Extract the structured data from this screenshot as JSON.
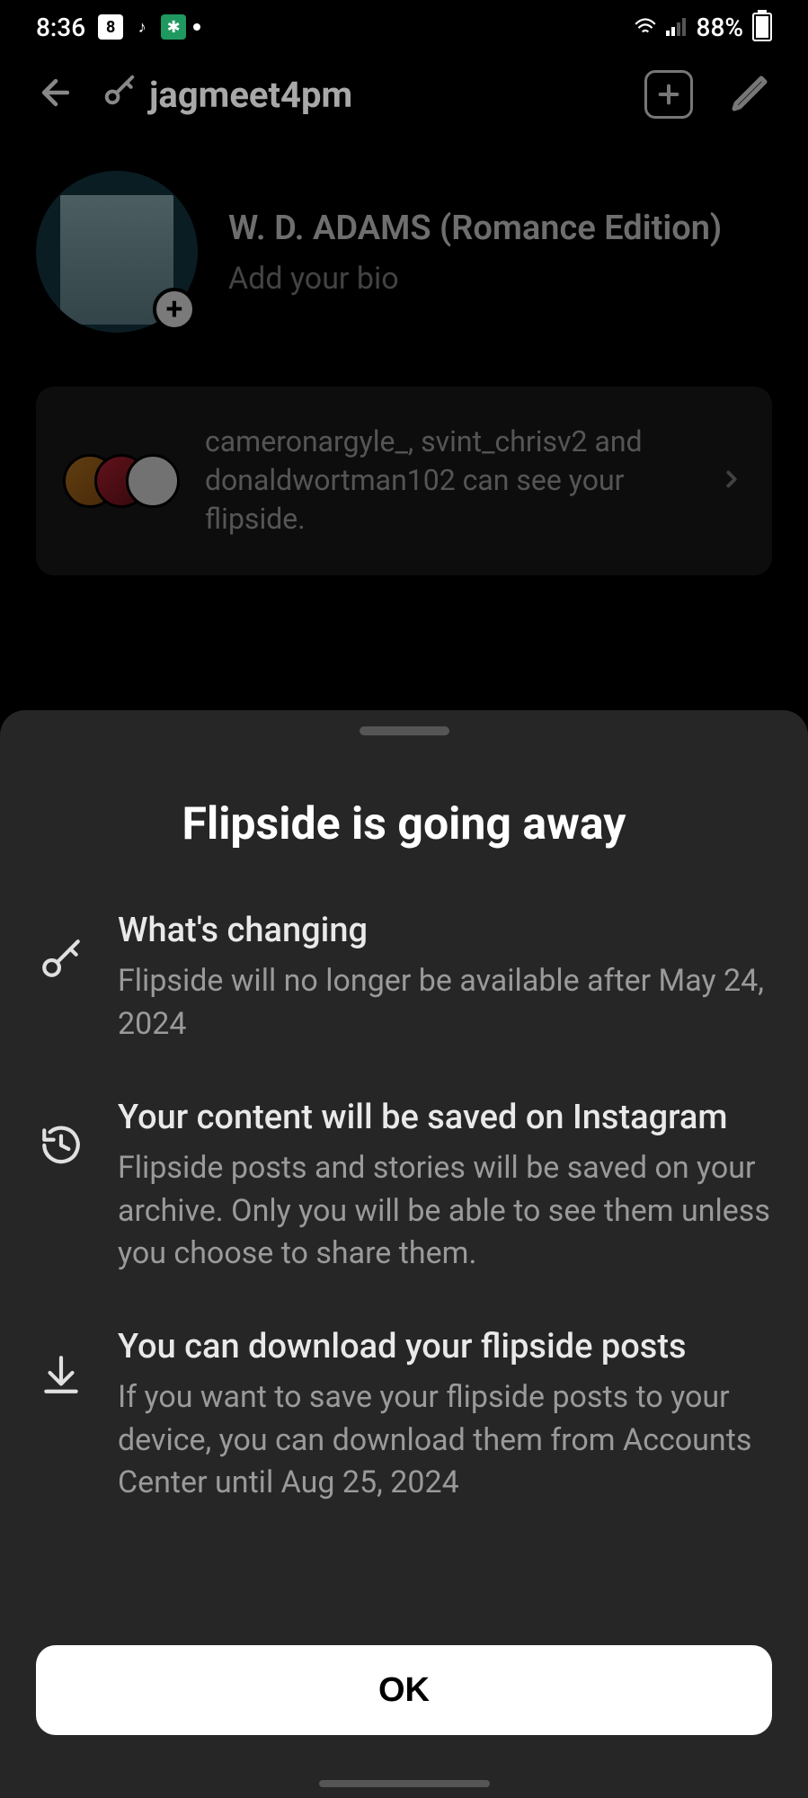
{
  "status": {
    "time": "8:36",
    "battery_pct": "88%"
  },
  "header": {
    "username": "jagmeet4pm"
  },
  "profile": {
    "display_name": "W. D. ADAMS (Romance Edition)",
    "bio_prompt": "Add your bio"
  },
  "viewers": {
    "text": "cameronargyle_, svint_chrisv2 and donaldwortman102 can see your flipside."
  },
  "sheet": {
    "title": "Flipside is going away",
    "items": [
      {
        "title": "What's changing",
        "body": "Flipside will no longer be available after May 24, 2024"
      },
      {
        "title": "Your content will be saved on Instagram",
        "body": "Flipside posts and stories will be saved on your archive. Only you will be able to see them unless you choose to share them."
      },
      {
        "title": "You can download your flipside posts",
        "body": "If you want to save your flipside posts to your device, you can download them from Accounts Center until Aug 25, 2024"
      }
    ],
    "ok_label": "OK"
  }
}
